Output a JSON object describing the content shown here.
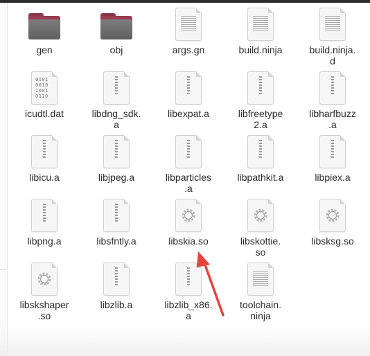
{
  "files": [
    {
      "label": "gen",
      "icon": "folder-icon"
    },
    {
      "label": "obj",
      "icon": "folder-icon"
    },
    {
      "label": "args.gn",
      "icon": "text-file-icon"
    },
    {
      "label": "build.ninja",
      "icon": "text-file-icon"
    },
    {
      "label": "build.ninja.\nd",
      "icon": "text-file-icon"
    },
    {
      "label": "icudtl.dat",
      "icon": "binary-file-icon"
    },
    {
      "label": "libdng_sdk.\na",
      "icon": "archive-file-icon"
    },
    {
      "label": "libexpat.a",
      "icon": "archive-file-icon"
    },
    {
      "label": "libfreetype\n2.a",
      "icon": "archive-file-icon"
    },
    {
      "label": "libharfbuzz\n.a",
      "icon": "archive-file-icon"
    },
    {
      "label": "libicu.a",
      "icon": "archive-file-icon"
    },
    {
      "label": "libjpeg.a",
      "icon": "archive-file-icon"
    },
    {
      "label": "libparticles\n.a",
      "icon": "archive-file-icon"
    },
    {
      "label": "libpathkit.a",
      "icon": "archive-file-icon"
    },
    {
      "label": "libpiex.a",
      "icon": "archive-file-icon"
    },
    {
      "label": "libpng.a",
      "icon": "archive-file-icon"
    },
    {
      "label": "libsfntly.a",
      "icon": "archive-file-icon"
    },
    {
      "label": "libskia.so",
      "icon": "shared-library-icon"
    },
    {
      "label": "libskottie.\nso",
      "icon": "shared-library-icon"
    },
    {
      "label": "libsksg.so",
      "icon": "shared-library-icon"
    },
    {
      "label": "libskshaper\n.so",
      "icon": "shared-library-icon"
    },
    {
      "label": "libzlib.a",
      "icon": "archive-file-icon"
    },
    {
      "label": "libzlib_x86.\na",
      "icon": "archive-file-icon"
    },
    {
      "label": "toolchain.\nninja",
      "icon": "text-file-icon"
    }
  ],
  "colors": {
    "folder_tab": "#9b3d52",
    "folder_body": "#6e6e6e",
    "annotation_arrow": "#e8443a",
    "label_text": "#2b2b2b"
  }
}
